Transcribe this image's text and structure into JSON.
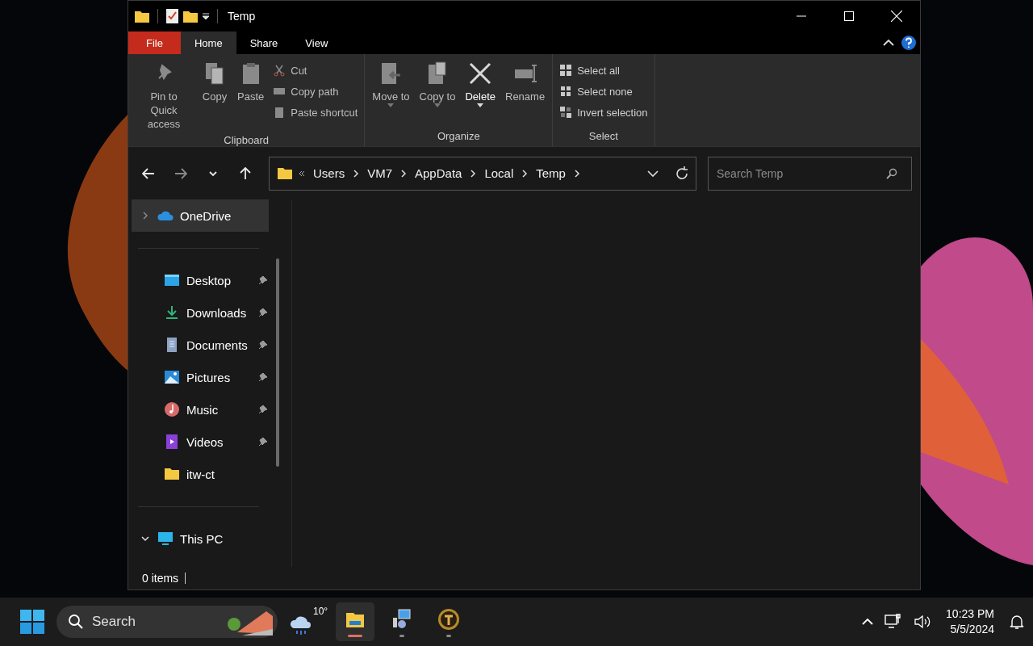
{
  "window": {
    "title": "Temp"
  },
  "ribbon_tabs": [
    {
      "label": "File",
      "kind": "file",
      "selected": false
    },
    {
      "label": "Home",
      "kind": "tab",
      "selected": true
    },
    {
      "label": "Share",
      "kind": "tab",
      "selected": false
    },
    {
      "label": "View",
      "kind": "tab",
      "selected": false
    }
  ],
  "ribbon_groups": [
    {
      "label": "Clipboard",
      "items": [
        {
          "kind": "large",
          "label": "Pin to Quick access",
          "disabled": true,
          "has_menu": false
        },
        {
          "kind": "large",
          "label": "Copy",
          "disabled": true,
          "has_menu": false
        },
        {
          "kind": "large",
          "label": "Paste",
          "disabled": true,
          "has_menu": false
        },
        {
          "kind": "stack",
          "items": [
            {
              "label": "Cut",
              "disabled": true
            },
            {
              "label": "Copy path",
              "disabled": true
            },
            {
              "label": "Paste shortcut",
              "disabled": true
            }
          ]
        }
      ]
    },
    {
      "label": "Organize",
      "items": [
        {
          "kind": "large",
          "label": "Move to",
          "disabled": true,
          "has_menu": true
        },
        {
          "kind": "large",
          "label": "Copy to",
          "disabled": true,
          "has_menu": true
        },
        {
          "kind": "large",
          "label": "Delete",
          "disabled": false,
          "has_menu": true
        },
        {
          "kind": "large",
          "label": "Rename",
          "disabled": true,
          "has_menu": false
        }
      ]
    },
    {
      "label": "Select",
      "items": [
        {
          "kind": "stack",
          "items": [
            {
              "label": "Select all",
              "disabled": false
            },
            {
              "label": "Select none",
              "disabled": false
            },
            {
              "label": "Invert selection",
              "disabled": false
            }
          ]
        }
      ]
    }
  ],
  "nav_buttons": [
    {
      "kind": "back",
      "disabled": false
    },
    {
      "kind": "forward",
      "disabled": true
    },
    {
      "kind": "recent",
      "disabled": false
    },
    {
      "kind": "up",
      "disabled": false
    }
  ],
  "address": {
    "path": [
      "Users",
      "VM7",
      "AppData",
      "Local",
      "Temp"
    ]
  },
  "search": {
    "placeholder": "Search Temp"
  },
  "nav_pane": [
    {
      "kind": "cloud",
      "label": "OneDrive",
      "selected": true,
      "expanded": false,
      "pinned": false
    },
    {
      "kind": "desktop",
      "label": "Desktop",
      "selected": false,
      "pinned": true
    },
    {
      "kind": "downloads",
      "label": "Downloads",
      "selected": false,
      "pinned": true
    },
    {
      "kind": "documents",
      "label": "Documents",
      "selected": false,
      "pinned": true
    },
    {
      "kind": "pictures",
      "label": "Pictures",
      "selected": false,
      "pinned": true
    },
    {
      "kind": "music",
      "label": "Music",
      "selected": false,
      "pinned": true
    },
    {
      "kind": "videos",
      "label": "Videos",
      "selected": false,
      "pinned": true
    },
    {
      "kind": "folder",
      "label": "itw-ct",
      "selected": false,
      "pinned": false
    },
    {
      "kind": "pc",
      "label": "This PC",
      "selected": false,
      "expanded": true,
      "pinned": false
    }
  ],
  "status_bar": {
    "items": "0 items"
  },
  "taskbar": {
    "search_placeholder": "Search",
    "weather": "10°",
    "apps": [
      {
        "kind": "explorer",
        "active": true,
        "running": true
      },
      {
        "kind": "installer",
        "active": false,
        "running": true
      },
      {
        "kind": "ct",
        "active": false,
        "running": true
      }
    ],
    "time": "10:23 PM",
    "date": "5/5/2024"
  }
}
